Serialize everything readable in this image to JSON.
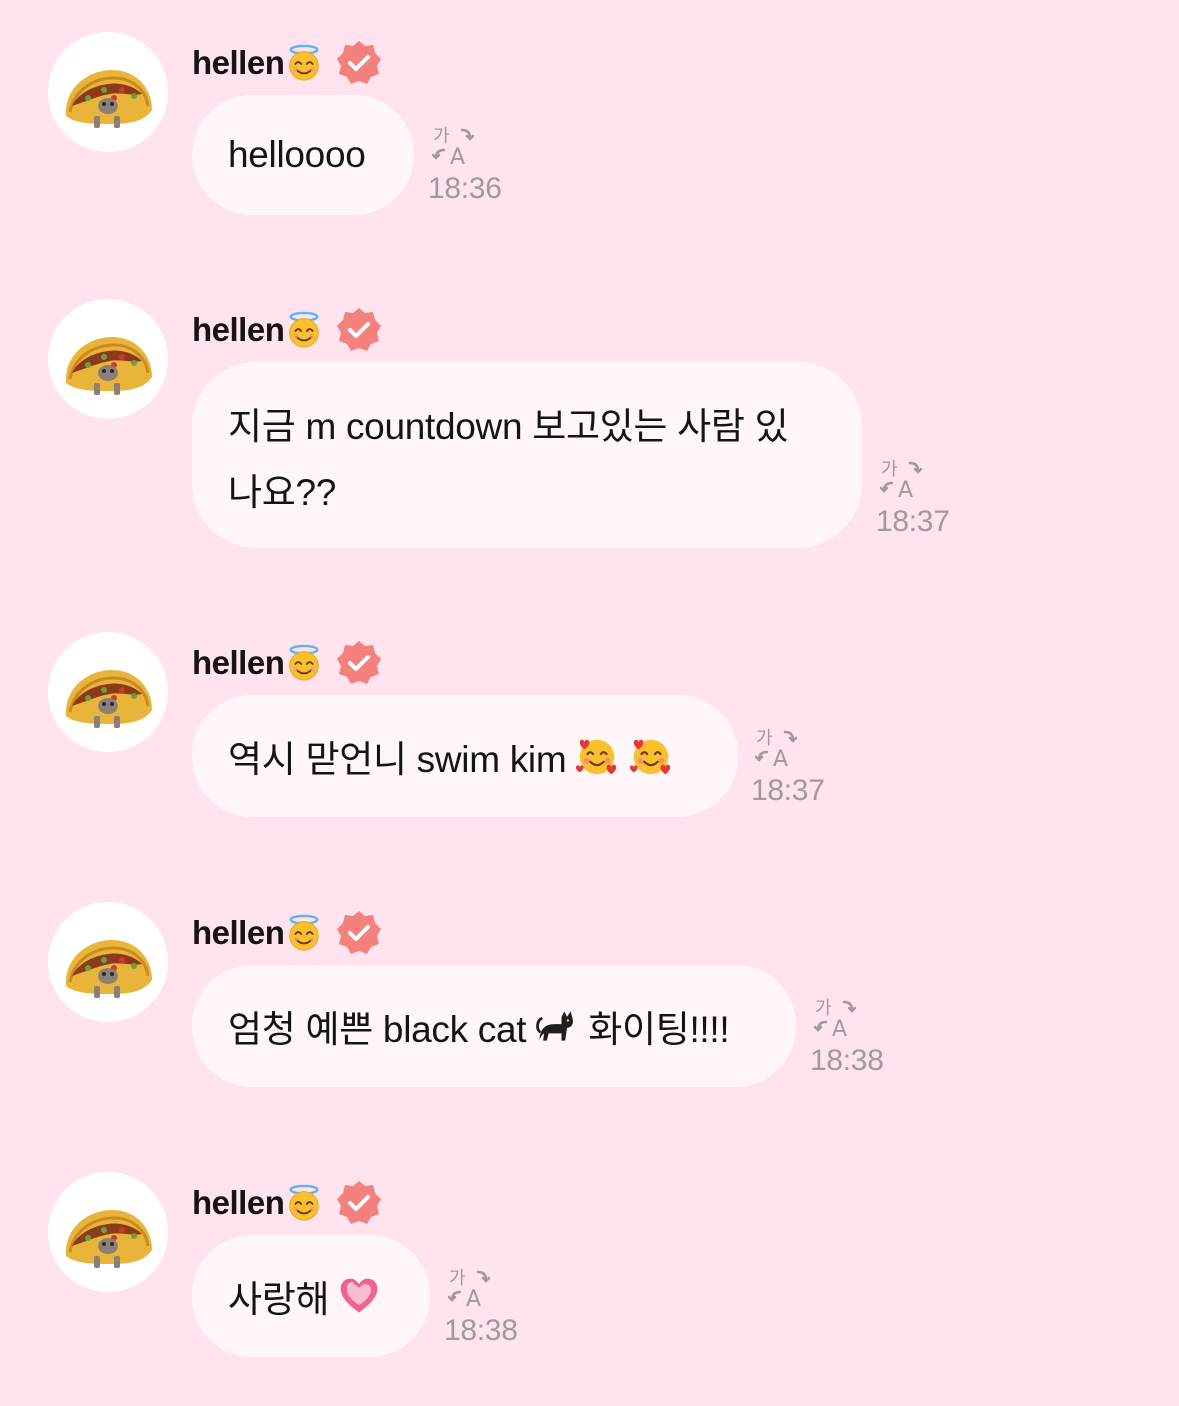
{
  "colors": {
    "background": "#FFE3EF",
    "bubble": "#FFF6FA",
    "verified_badge": "#F4817D",
    "timestamp": "#A09AA0"
  },
  "messages": [
    {
      "author": "hellen",
      "author_emoji": "smiling-face-with-halo",
      "verified": true,
      "lines": [
        "helloooo"
      ],
      "emojis": [],
      "time": "18:36"
    },
    {
      "author": "hellen",
      "author_emoji": "smiling-face-with-halo",
      "verified": true,
      "lines": [
        "지금 m countdown 보고있는 사람 있",
        "나요??"
      ],
      "emojis": [],
      "time": "18:37"
    },
    {
      "author": "hellen",
      "author_emoji": "smiling-face-with-halo",
      "verified": true,
      "lines": [
        "역시 맏언니 swim kim"
      ],
      "emojis": [
        "smiling-face-with-hearts",
        "smiling-face-with-hearts"
      ],
      "time": "18:37"
    },
    {
      "author": "hellen",
      "author_emoji": "smiling-face-with-halo",
      "verified": true,
      "lines": [
        "엄청 예쁜 black cat",
        "화이팅!!!!"
      ],
      "emojis": [
        "black-cat"
      ],
      "time": "18:38"
    },
    {
      "author": "hellen",
      "author_emoji": "smiling-face-with-halo",
      "verified": true,
      "lines": [
        "사랑해"
      ],
      "emojis": [
        "growing-heart"
      ],
      "time": "18:38"
    }
  ],
  "icons": {
    "translate": "translate-icon",
    "verified": "verified-badge-icon",
    "avatar": "taco-avatar"
  }
}
